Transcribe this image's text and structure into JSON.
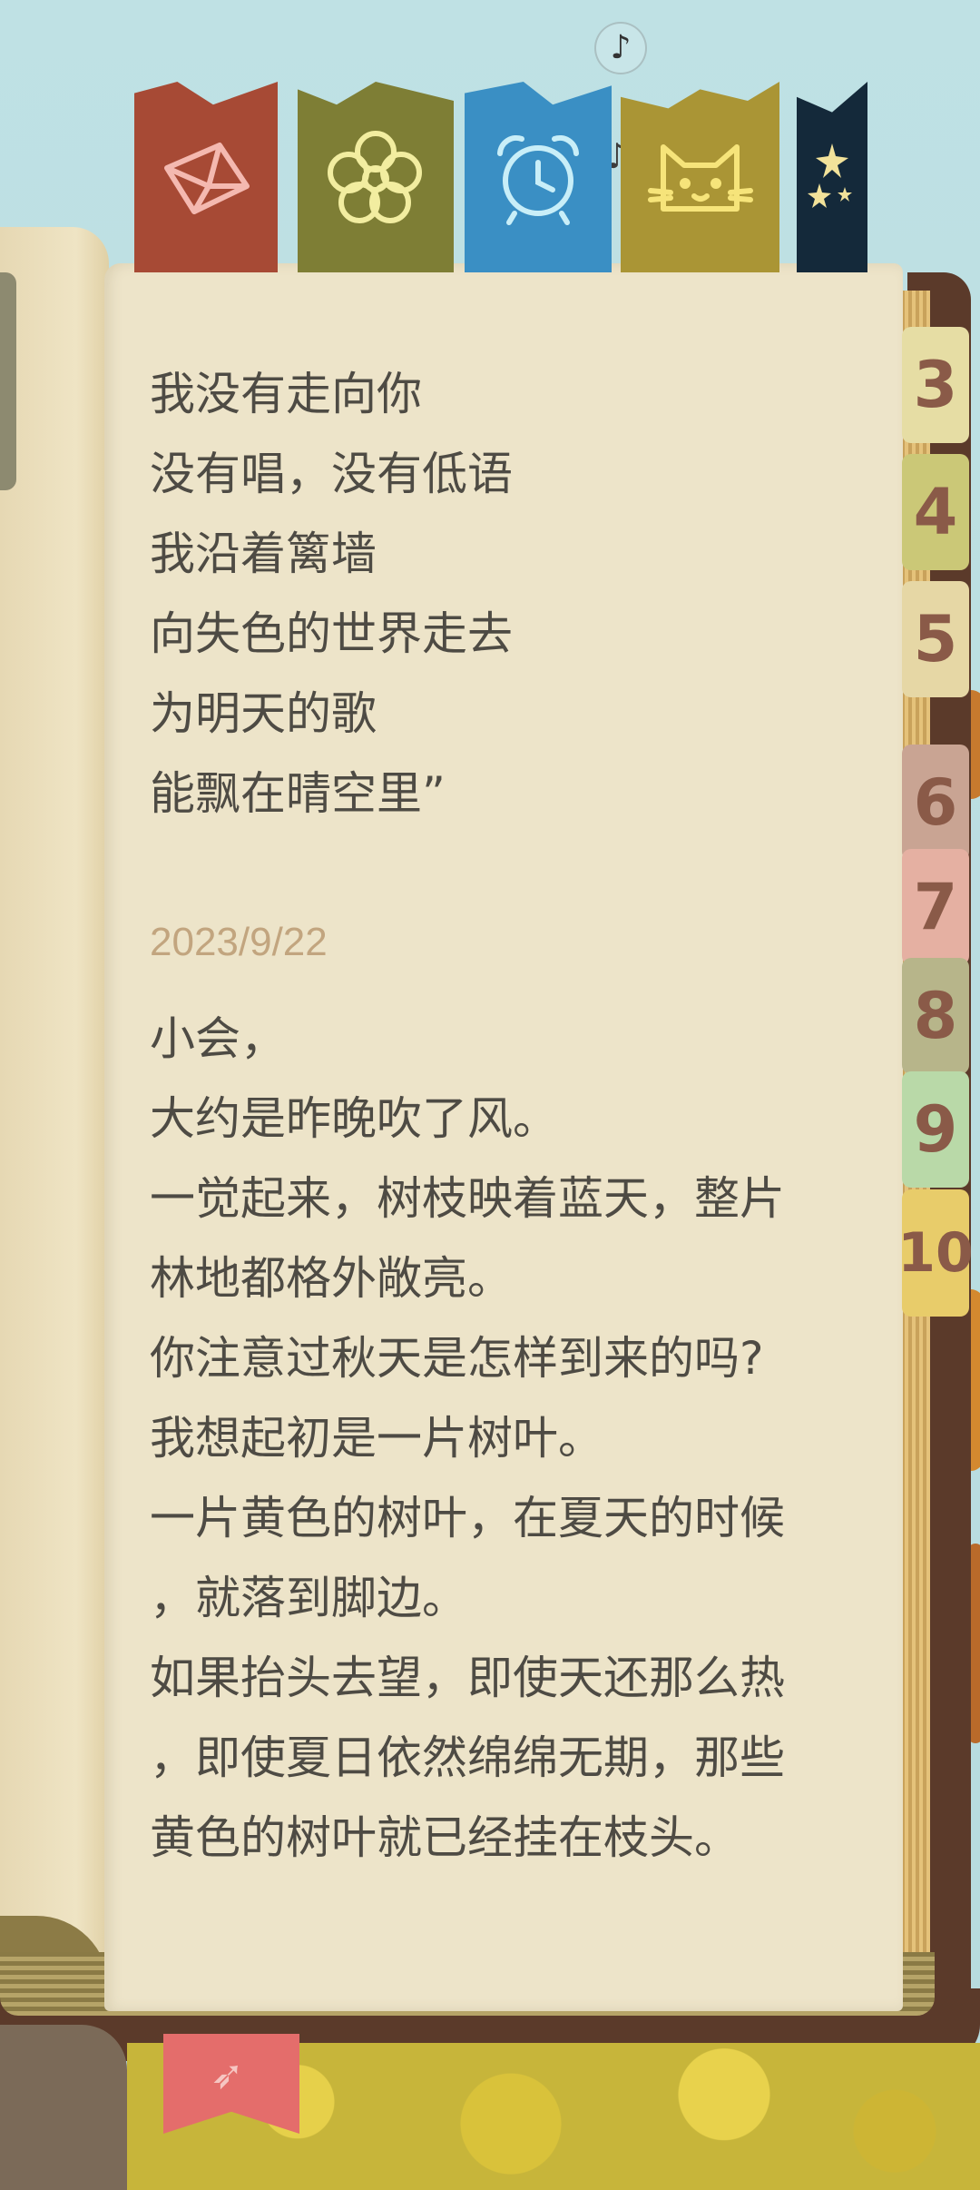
{
  "music": {
    "icon": "music-note-icon",
    "glyph": "♪"
  },
  "category_tabs": [
    {
      "name": "mail",
      "icon": "envelope-icon",
      "color": "#a74a35"
    },
    {
      "name": "flower",
      "icon": "flower-icon",
      "color": "#7e7e35"
    },
    {
      "name": "clock",
      "icon": "alarm-clock-icon",
      "color": "#3a8fc4"
    },
    {
      "name": "cat",
      "icon": "cat-icon",
      "color": "#aa9535"
    },
    {
      "name": "stars",
      "icon": "stars-icon",
      "color": "#14293a"
    }
  ],
  "number_tabs": [
    "3",
    "4",
    "5",
    "6",
    "7",
    "8",
    "9",
    "10"
  ],
  "poem_lines": [
    "我没有走向你",
    "没有唱，没有低语",
    "我沿着篱墙",
    "向失色的世界走去",
    "为明天的歌",
    "能飘在晴空里”"
  ],
  "entry": {
    "date": "2023/9/22",
    "lines": [
      "小会，",
      "大约是昨晚吹了风。",
      "一觉起来，树枝映着蓝天，整片",
      "林地都格外敞亮。",
      "你注意过秋天是怎样到来的吗?",
      "我想起初是一片树叶。",
      "一片黄色的树叶，在夏天的时候",
      "，就落到脚边。",
      "如果抬头去望，即使天还那么热",
      "，即使夏日依然绵绵无期，那些",
      "黄色的树叶就已经挂在枝头。"
    ]
  },
  "bookmark": {
    "icon": "bird-bookmark-icon",
    "color": "#e46d6b"
  }
}
